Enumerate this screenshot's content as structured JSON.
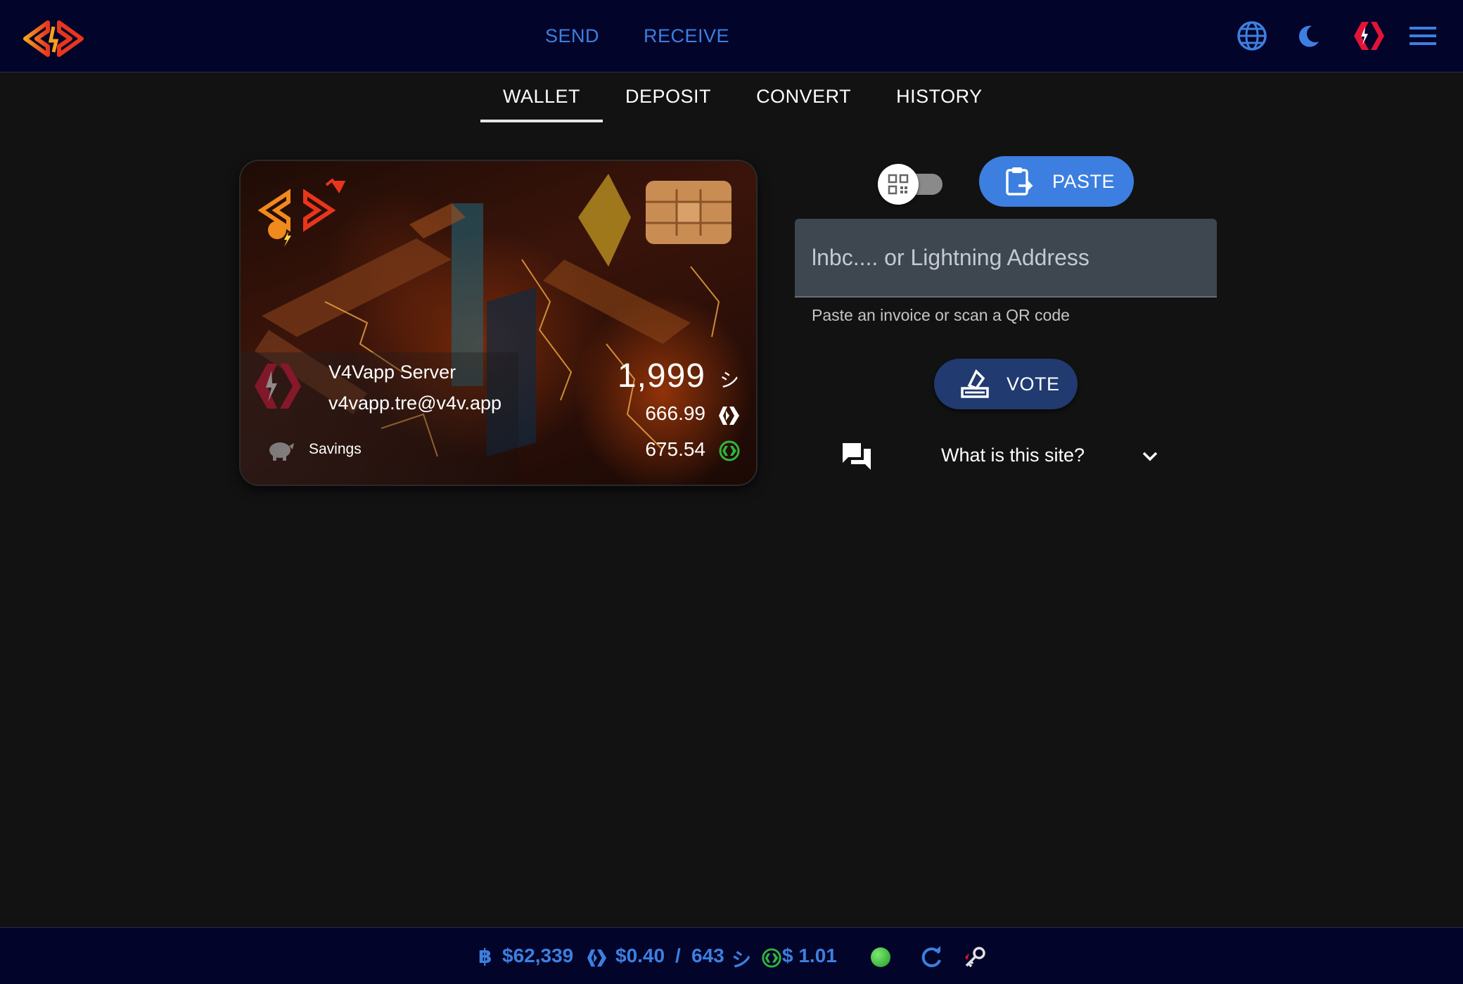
{
  "header": {
    "send_label": "SEND",
    "receive_label": "RECEIVE"
  },
  "tabs": [
    {
      "label": "WALLET",
      "active": true
    },
    {
      "label": "DEPOSIT"
    },
    {
      "label": "CONVERT"
    },
    {
      "label": "HISTORY"
    }
  ],
  "card": {
    "account_name": "V4Vapp Server",
    "address": "v4vapp.tre@v4v.app",
    "savings_label": "Savings",
    "sats_balance": "1,999",
    "sats_symbol": "シ",
    "hive_balance": "666.99",
    "hbd_balance": "675.54"
  },
  "actions": {
    "paste_label": "PASTE",
    "input_placeholder": "lnbc.... or Lightning Address",
    "input_hint": "Paste an invoice or scan a QR code",
    "vote_label": "VOTE",
    "faq_label": "What is this site?"
  },
  "footer": {
    "btc_symbol": "฿",
    "btc_price": "$62,339",
    "hive_price": "$0.40",
    "separator": "/",
    "sats_per_hive": "643",
    "sats_symbol": "シ",
    "hbd_price": "$ 1.01"
  },
  "colors": {
    "accent_blue": "#3d7fe0",
    "hive_red": "#e31337",
    "status_green": "#2fb63a",
    "topbar_bg": "#03042a"
  }
}
